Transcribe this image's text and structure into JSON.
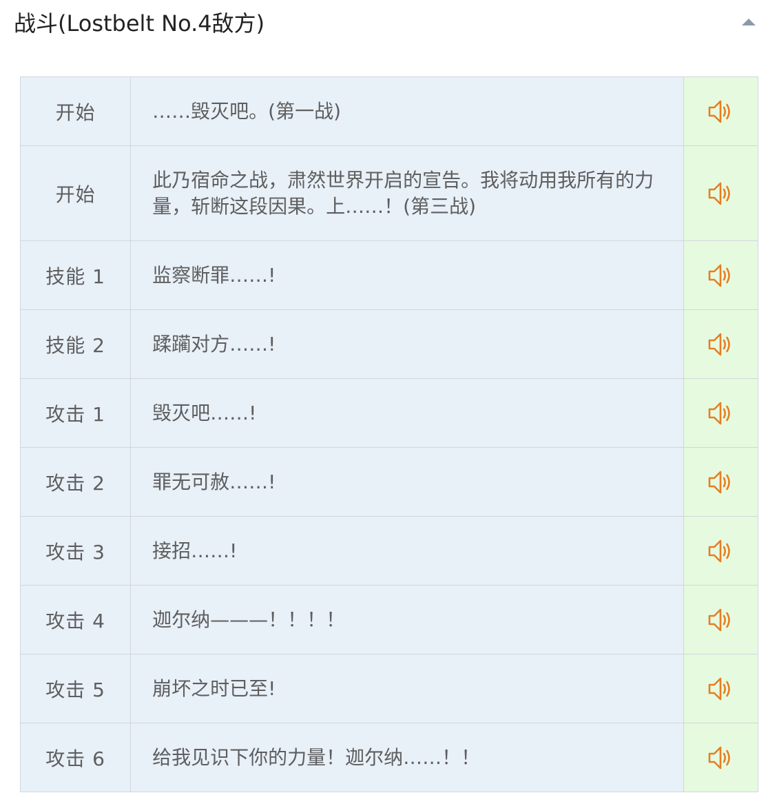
{
  "section": {
    "title": "战斗(Lostbelt No.4敌方)"
  },
  "icons": {
    "toggle": "triangle-up-icon",
    "play": "speaker-icon"
  },
  "colors": {
    "label_bg": "#e8f0f8",
    "play_bg": "#e6fadf",
    "speaker": "#e67e22",
    "toggle": "#8a9aa9",
    "border": "#cfd6de"
  },
  "rows": [
    {
      "label": "开始",
      "text": "……毁灭吧。(第一战)"
    },
    {
      "label": "开始",
      "text": "此乃宿命之战，肃然世界开启的宣告。我将动用我所有的力量，斩断这段因果。上……！(第三战)"
    },
    {
      "label": "技能 1",
      "text": "监察断罪……!"
    },
    {
      "label": "技能 2",
      "text": "蹂躏对方……!"
    },
    {
      "label": "攻击 1",
      "text": "毁灭吧……!"
    },
    {
      "label": "攻击 2",
      "text": "罪无可赦……!"
    },
    {
      "label": "攻击 3",
      "text": "接招……!"
    },
    {
      "label": "攻击 4",
      "text": "迦尔纳———！！！！"
    },
    {
      "label": "攻击 5",
      "text": "崩坏之时已至!"
    },
    {
      "label": "攻击 6",
      "text": "给我见识下你的力量！迦尔纳……！！"
    }
  ]
}
